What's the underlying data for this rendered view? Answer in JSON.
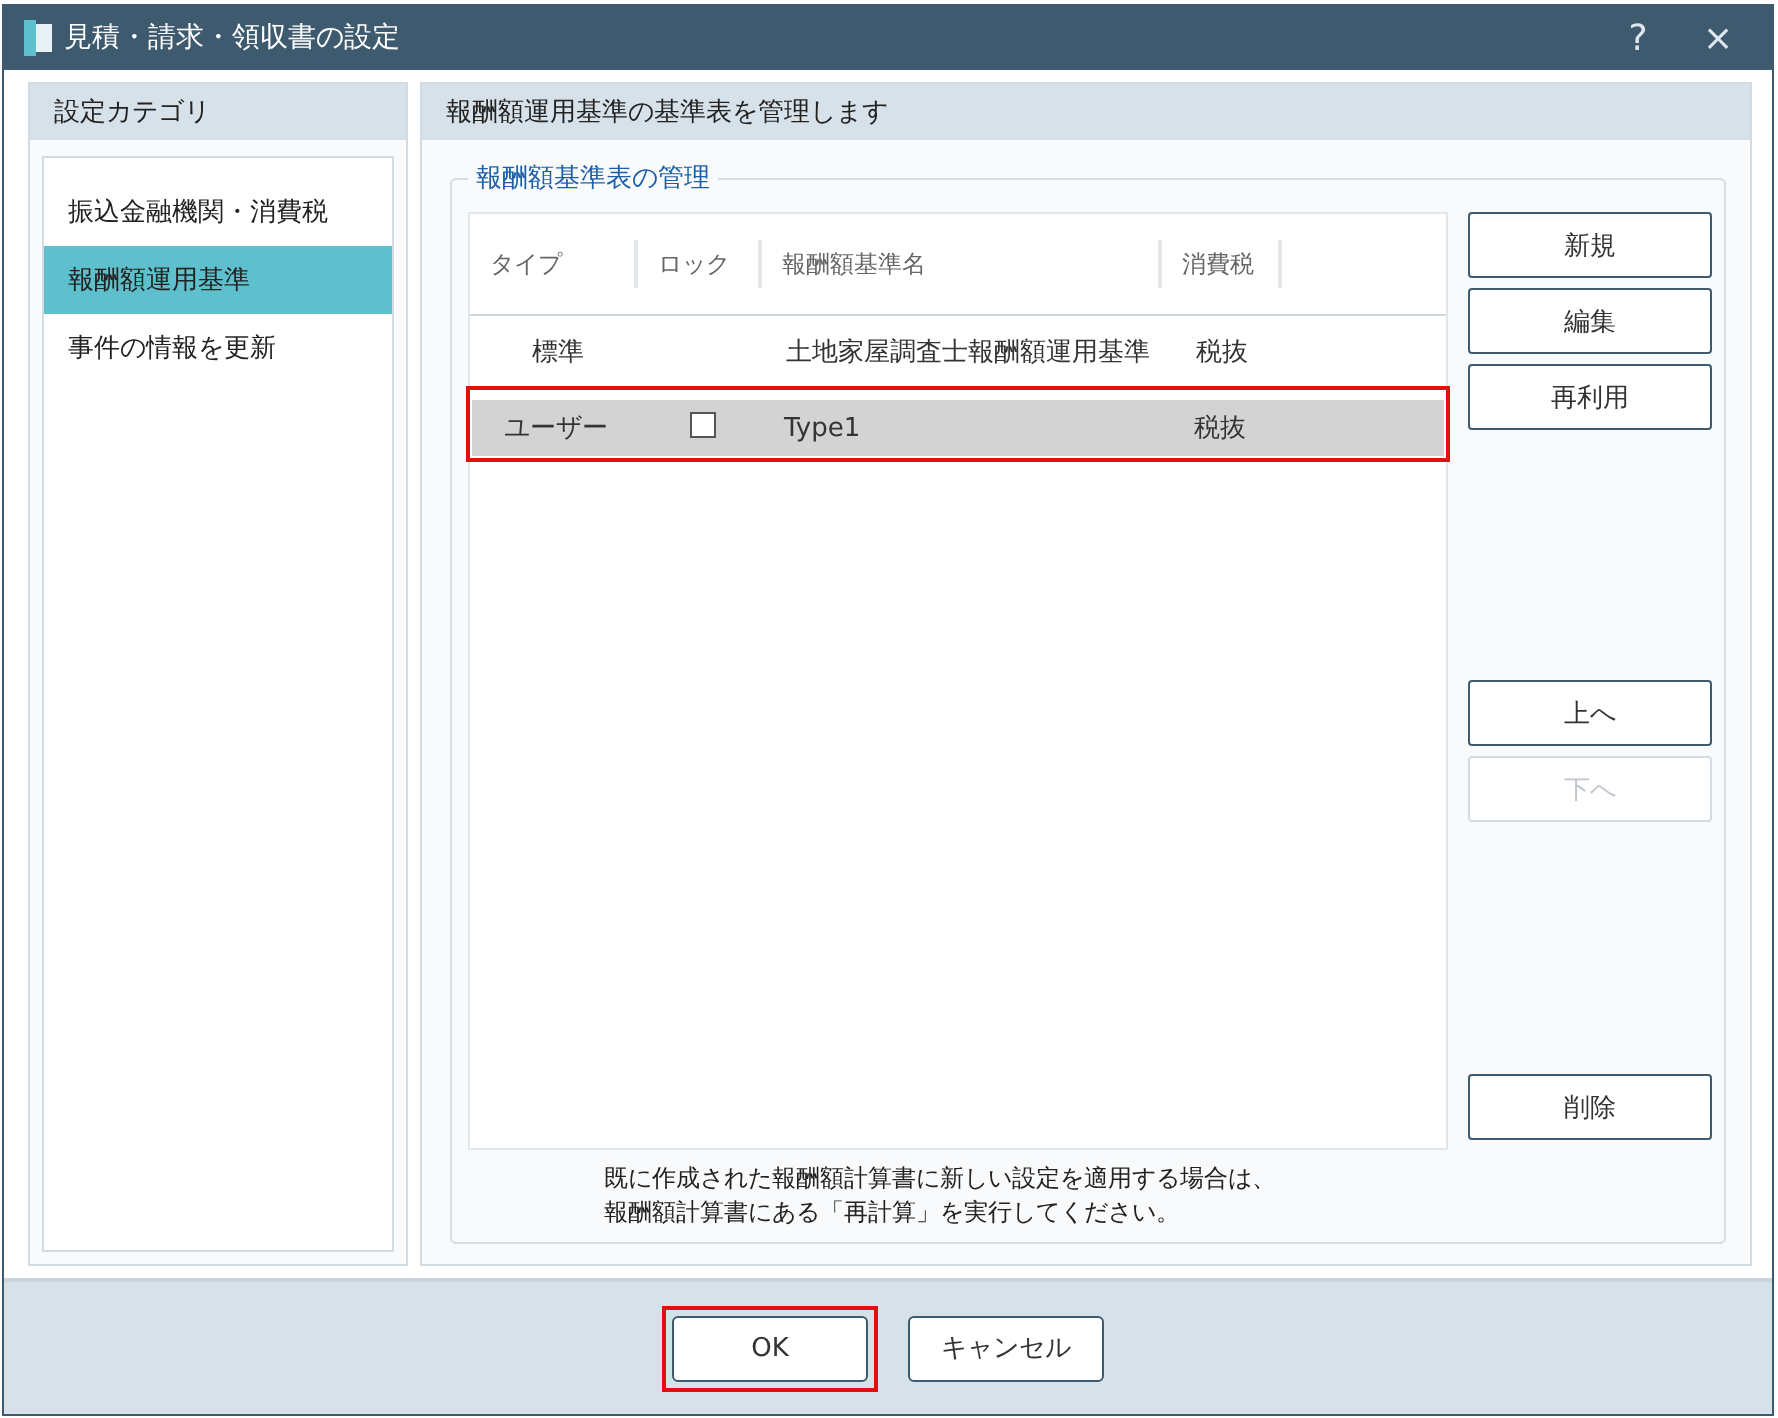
{
  "window": {
    "title": "見積・請求・領収書の設定",
    "help": "?",
    "close": "×"
  },
  "sidebar": {
    "title": "設定カテゴリ",
    "items": [
      {
        "label": "振込金融機関・消費税",
        "selected": false
      },
      {
        "label": "報酬額運用基準",
        "selected": true
      },
      {
        "label": "事件の情報を更新",
        "selected": false
      }
    ]
  },
  "main": {
    "title": "報酬額運用基準の基準表を管理します",
    "group_title": "報酬額基準表の管理",
    "table": {
      "columns": [
        "タイプ",
        "ロック",
        "報酬額基準名",
        "消費税"
      ],
      "rows": [
        {
          "type": "標準",
          "name": "土地家屋調査士報酬額運用基準",
          "tax": "税抜",
          "selected": false,
          "highlighted": false
        },
        {
          "type": "ユーザー",
          "lock": {
            "checked": false
          },
          "name": "Type1",
          "tax": "税抜",
          "selected": true,
          "highlighted": true
        }
      ]
    },
    "buttons_top": [
      {
        "label": "新規",
        "disabled": false
      },
      {
        "label": "編集",
        "disabled": false
      },
      {
        "label": "再利用",
        "disabled": false
      }
    ],
    "buttons_mid": [
      {
        "label": "上へ",
        "disabled": false
      },
      {
        "label": "下へ",
        "disabled": true
      }
    ],
    "buttons_bottom": [
      {
        "label": "削除",
        "disabled": false
      }
    ],
    "note": [
      "既に作成された報酬額計算書に新しい設定を適用する場合は、",
      "報酬額計算書にある「再計算」を実行してください。"
    ]
  },
  "footer": {
    "buttons": [
      {
        "label": "OK",
        "highlighted": true
      },
      {
        "label": "キャンセル",
        "highlighted": false
      }
    ]
  }
}
